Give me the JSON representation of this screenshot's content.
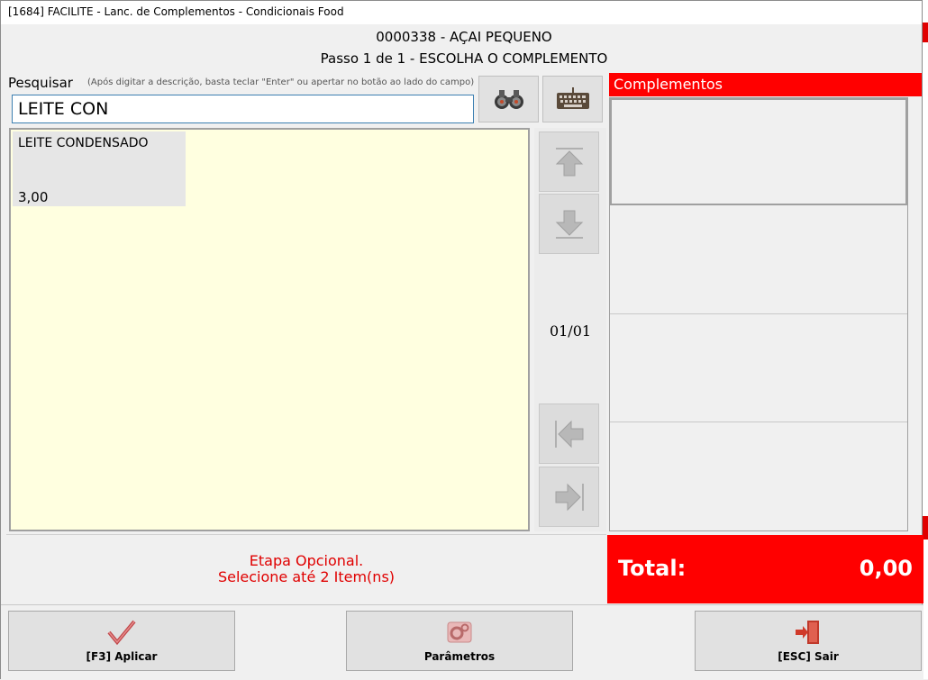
{
  "window": {
    "title": "[1684] FACILITE - Lanc. de Complementos - Condicionais Food"
  },
  "header": {
    "product": "0000338 - AÇAI PEQUENO",
    "step": "Passo 1 de 1 - ESCOLHA O COMPLEMENTO"
  },
  "search": {
    "label": "Pesquisar",
    "hint": "(Após digitar a descrição, basta teclar \"Enter\" ou apertar no botão ao lado do campo)",
    "value": "LEITE CON",
    "search_icon": "binoculars-icon",
    "keyboard_icon": "keyboard-icon"
  },
  "items": [
    {
      "name": "LEITE CONDENSADO",
      "price": "3,00"
    }
  ],
  "navigation": {
    "page": "01/01"
  },
  "complements": {
    "header": "Complementos"
  },
  "message": {
    "line1": "Etapa Opcional.",
    "line2": "Selecione até 2 Item(ns)"
  },
  "total": {
    "label": "Total:",
    "value": "0,00"
  },
  "footer": {
    "apply_label": "[F3] Aplicar",
    "params_label": "Parâmetros",
    "exit_label": "[ESC] Sair"
  },
  "colors": {
    "accent": "#ff0000",
    "list_bg": "#ffffe0",
    "message_text": "#e00000"
  }
}
